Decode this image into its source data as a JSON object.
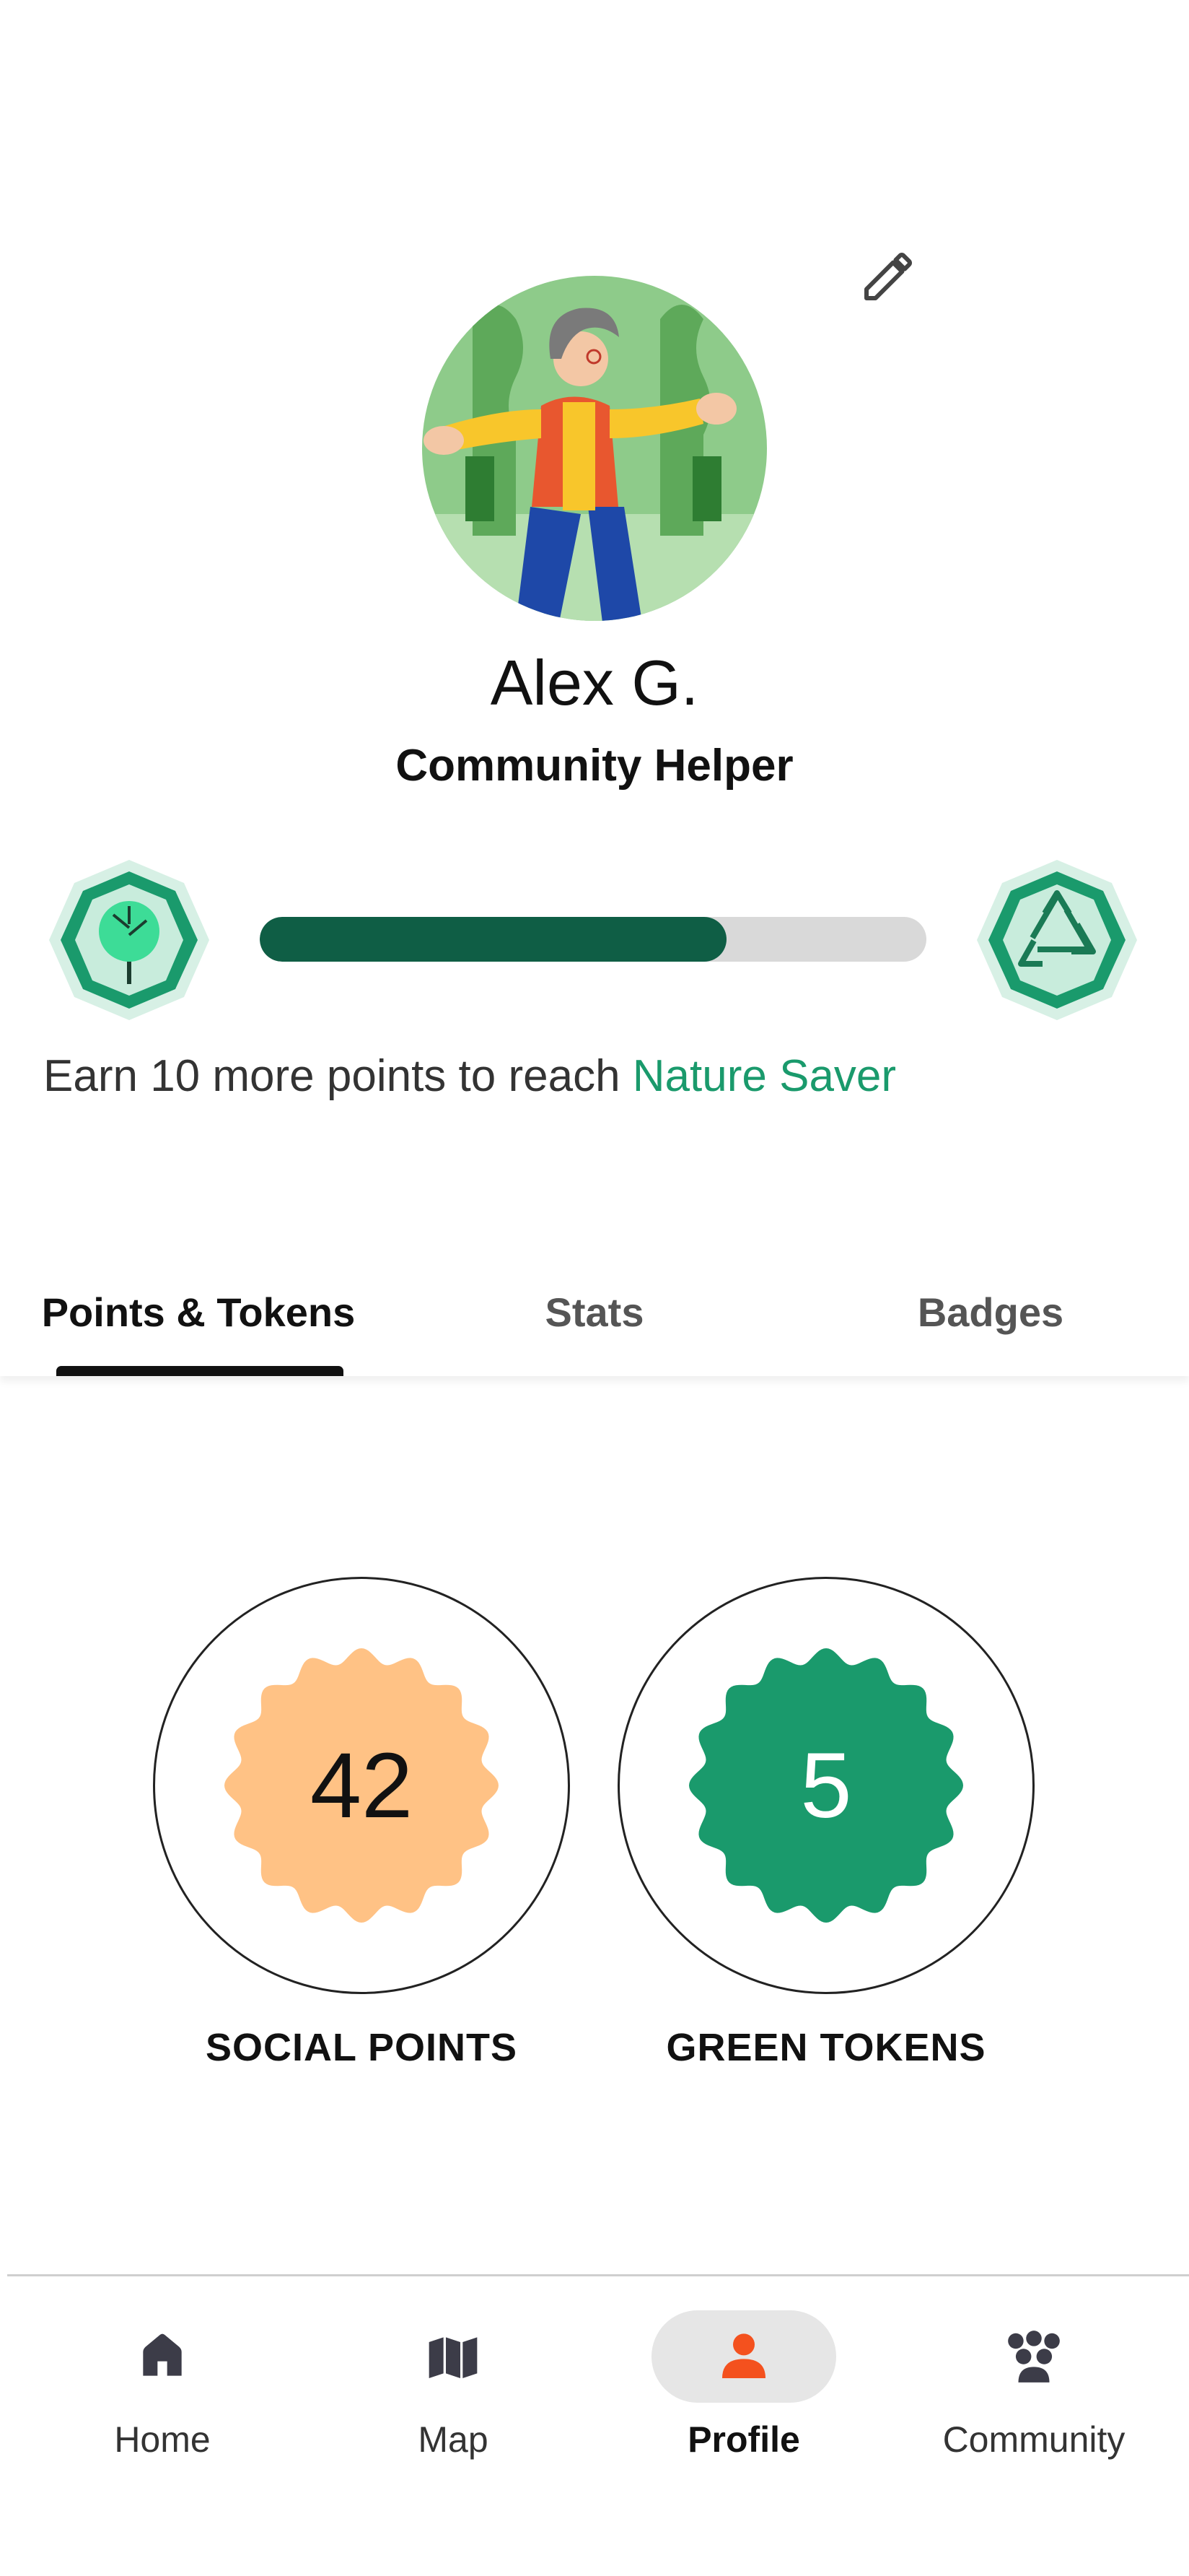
{
  "profile": {
    "name": "Alex G.",
    "role": "Community Helper",
    "edit_icon": "pencil-icon",
    "avatar_icon": "avatar-illustration"
  },
  "level": {
    "current_badge_icon": "tree-icon",
    "next_badge_icon": "recycle-icon",
    "progress_fraction": 0.7,
    "message_prefix": "Earn 10 more points to reach ",
    "next_level": "Nature Saver",
    "highlight_color": "#1a9a6c",
    "bar_color": "#0f5e45"
  },
  "tabs": [
    {
      "label": "Points & Tokens",
      "active": true
    },
    {
      "label": "Stats",
      "active": false
    },
    {
      "label": "Badges",
      "active": false
    }
  ],
  "stats": {
    "social_points": {
      "value": "42",
      "label": "SOCIAL POINTS",
      "color": "#ffc285"
    },
    "green_tokens": {
      "value": "5",
      "label": "GREEN TOKENS",
      "color": "#1a9a6c"
    }
  },
  "nav": [
    {
      "label": "Home",
      "icon": "home-icon",
      "active": false
    },
    {
      "label": "Map",
      "icon": "map-icon",
      "active": false
    },
    {
      "label": "Profile",
      "icon": "person-icon",
      "active": true,
      "accent": "#f4511e"
    },
    {
      "label": "Community",
      "icon": "group-icon",
      "active": false
    }
  ]
}
